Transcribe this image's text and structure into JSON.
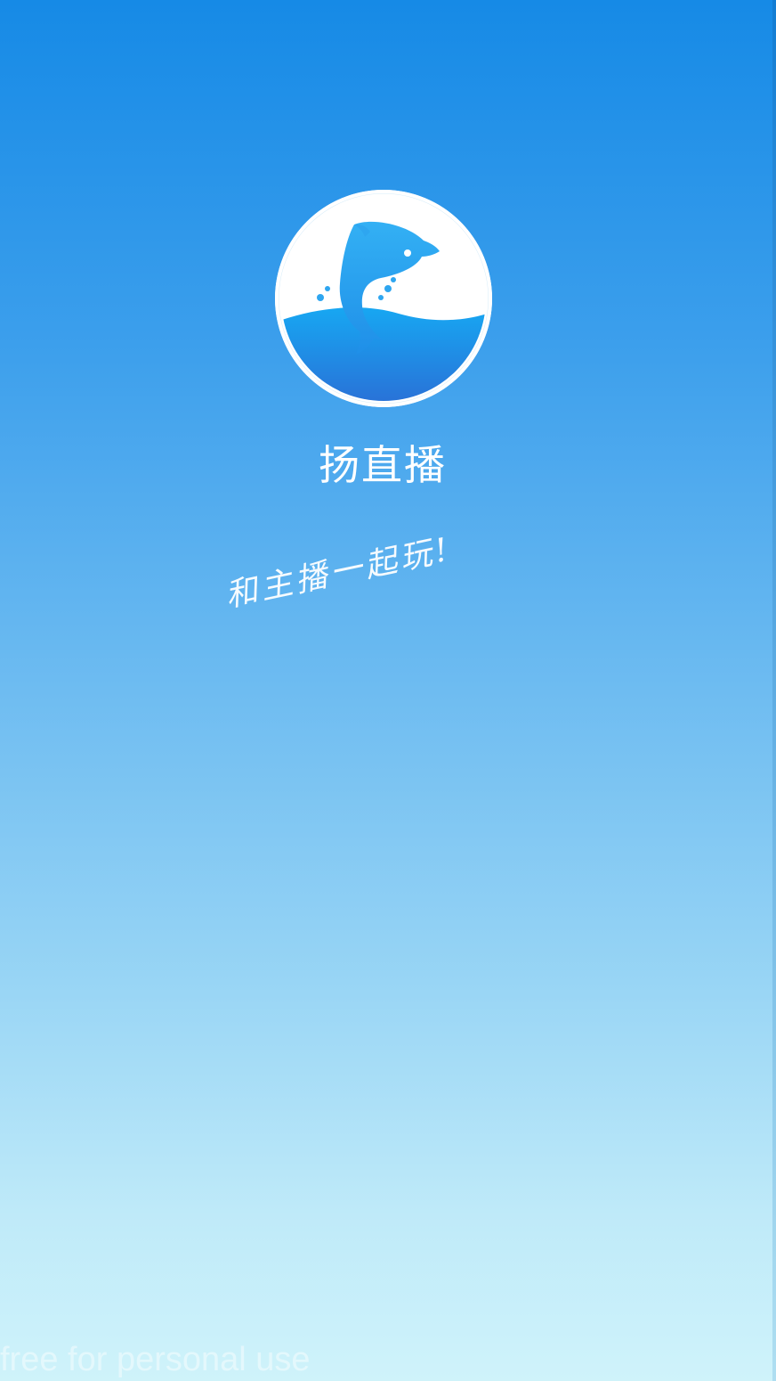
{
  "splash": {
    "logo_icon": "dolphin-logo-icon",
    "app_name": "扬直播",
    "slogan": "和主播一起玩!",
    "watermark": "free for personal use"
  },
  "colors": {
    "background_top": "#168ae6",
    "background_bottom": "#cff3fa",
    "logo_ring": "#ffffff",
    "dolphin": "#2ea6f0",
    "water_top": "#1aa3ef",
    "water_bottom": "#2a73d8",
    "text": "#ffffff"
  }
}
